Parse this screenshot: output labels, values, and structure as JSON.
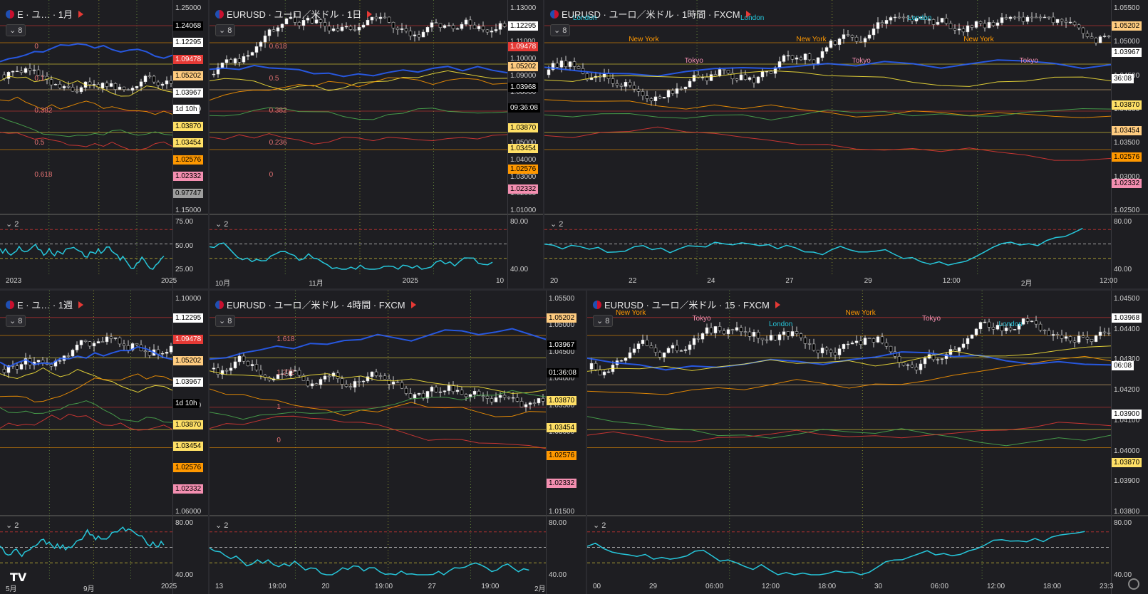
{
  "panes": [
    {
      "id": "p1",
      "title": "E · ユ… · 1月",
      "ind": "8",
      "osc": "2",
      "axis": [
        "1.25000",
        "1.20000",
        "1.15000",
        "75.00",
        "50.00",
        "25.00"
      ],
      "labels": [
        [
          "1.24068",
          "#000",
          "#fff"
        ],
        [
          "1.12295",
          "#fff",
          "#000"
        ],
        [
          "1.09478",
          "#e53935",
          "#fff"
        ],
        [
          "1.05202",
          "#ffcc80",
          "#000"
        ],
        [
          "1.03967",
          "#fff",
          "#000"
        ],
        [
          "1d 10h",
          "#fff",
          "#000"
        ],
        [
          "1.03870",
          "#ffe066",
          "#000"
        ],
        [
          "1.03454",
          "#ffe066",
          "#000"
        ],
        [
          "1.02576",
          "#ff9800",
          "#000"
        ],
        [
          "1.02332",
          "#f48fb1",
          "#000"
        ],
        [
          "0.97747",
          "#9e9e9e",
          "#000"
        ]
      ],
      "xl": [
        "2023",
        "2025"
      ],
      "fib": [
        "0",
        "0.1",
        "0.382",
        "0.5",
        "0.618"
      ]
    },
    {
      "id": "p2",
      "title": "EURUSD · ユーロ／米ドル · 1日",
      "ind": "8",
      "osc": "2",
      "axis": [
        "1.13000",
        "1.12000",
        "1.11000",
        "1.10000",
        "1.09000",
        "1.08000",
        "1.07000",
        "1.06000",
        "1.05000",
        "1.04000",
        "1.03000",
        "1.02000",
        "1.01000",
        "80.00",
        "40.00"
      ],
      "labels": [
        [
          "1.12295",
          "#fff",
          "#000"
        ],
        [
          "1.09478",
          "#e53935",
          "#fff"
        ],
        [
          "1.05202",
          "#ffcc80",
          "#000"
        ],
        [
          "1.03968",
          "#000",
          "#fff"
        ],
        [
          "09:36:08",
          "#000",
          "#fff"
        ],
        [
          "1.03870",
          "#ffe066",
          "#000"
        ],
        [
          "1.03454",
          "#ffe066",
          "#000"
        ],
        [
          "1.02576",
          "#ff9800",
          "#000"
        ],
        [
          "1.02332",
          "#f48fb1",
          "#000"
        ]
      ],
      "xl": [
        "10月",
        "11月",
        "2025",
        "10"
      ],
      "fib": [
        "0.618",
        "0.5",
        "0.382",
        "0.236",
        "0"
      ]
    },
    {
      "id": "p3",
      "title": "EURUSD · ユーロ／米ドル · 1時間 · FXCM",
      "ind": "8",
      "osc": "2",
      "axis": [
        "1.05500",
        "1.05000",
        "1.04500",
        "1.04000",
        "1.03500",
        "1.03000",
        "1.02500",
        "80.00",
        "40.00"
      ],
      "labels": [
        [
          "1.05202",
          "#ffcc80",
          "#000"
        ],
        [
          "1.03967",
          "#fff",
          "#000"
        ],
        [
          "36:08",
          "#fff",
          "#000"
        ],
        [
          "1.03870",
          "#ffe066",
          "#000"
        ],
        [
          "1.03454",
          "#ffcc80",
          "#000"
        ],
        [
          "1.02576",
          "#ff9800",
          "#000"
        ],
        [
          "1.02332",
          "#f48fb1",
          "#000"
        ]
      ],
      "xl": [
        "20",
        "22",
        "24",
        "27",
        "29",
        "12:00",
        "2月",
        "12:00"
      ],
      "sessions": [
        "London",
        "New York",
        "Tokyo",
        "London",
        "New York",
        "Tokyo",
        "London",
        "New York",
        "Tokyo"
      ]
    },
    {
      "id": "p4",
      "title": "E · ユ… · 1週",
      "ind": "8",
      "osc": "2",
      "axis": [
        "1.10000",
        "1.08000",
        "1.06000",
        "80.00",
        "40.00"
      ],
      "labels": [
        [
          "1.12295",
          "#fff",
          "#000"
        ],
        [
          "1.09478",
          "#e53935",
          "#fff"
        ],
        [
          "1.05202",
          "#ffcc80",
          "#000"
        ],
        [
          "1.03967",
          "#fff",
          "#000"
        ],
        [
          "1d 10h",
          "#000",
          "#fff"
        ],
        [
          "1.03870",
          "#ffe066",
          "#000"
        ],
        [
          "1.03454",
          "#ffe066",
          "#000"
        ],
        [
          "1.02576",
          "#ff9800",
          "#000"
        ],
        [
          "1.02332",
          "#f48fb1",
          "#000"
        ]
      ],
      "xl": [
        "5月",
        "9月",
        "2025"
      ]
    },
    {
      "id": "p5",
      "title": "EURUSD · ユーロ／米ドル · 4時間 · FXCM",
      "ind": "8",
      "osc": "2",
      "axis": [
        "1.05500",
        "1.05000",
        "1.04500",
        "1.04000",
        "1.03500",
        "1.03000",
        "1.02500",
        "1.02000",
        "1.01500",
        "80.00",
        "40.00"
      ],
      "labels": [
        [
          "1.05202",
          "#ffcc80",
          "#000"
        ],
        [
          "1.03967",
          "#000",
          "#fff"
        ],
        [
          "01:36:08",
          "#000",
          "#fff"
        ],
        [
          "1.03870",
          "#ffe066",
          "#000"
        ],
        [
          "1.03454",
          "#ffe066",
          "#000"
        ],
        [
          "1.02576",
          "#ff9800",
          "#000"
        ],
        [
          "1.02332",
          "#f48fb1",
          "#000"
        ]
      ],
      "xl": [
        "13",
        "19:00",
        "20",
        "19:00",
        "27",
        "19:00",
        "2月"
      ],
      "fib": [
        "1.618",
        "1.272",
        "1",
        "0"
      ]
    },
    {
      "id": "p6",
      "title": "EURUSD · ユーロ／米ドル · 15 · FXCM",
      "ind": "8",
      "osc": "2",
      "axis": [
        "1.04500",
        "1.04400",
        "1.04300",
        "1.04200",
        "1.04100",
        "1.04000",
        "1.03900",
        "1.03800",
        "80.00",
        "40.00"
      ],
      "labels": [
        [
          "1.03968",
          "#fff",
          "#000"
        ],
        [
          "06:08",
          "#fff",
          "#000"
        ],
        [
          "1.03900",
          "#fff",
          "#000"
        ],
        [
          "1.03870",
          "#ffe066",
          "#000"
        ]
      ],
      "xl": [
        "00",
        "29",
        "06:00",
        "12:00",
        "18:00",
        "30",
        "06:00",
        "12:00",
        "18:00",
        "23:3"
      ],
      "sessions": [
        "New York",
        "Tokyo",
        "London",
        "New York",
        "Tokyo",
        "London"
      ]
    }
  ],
  "colors": {
    "bg": "#1e1e22",
    "grid": "#2f2f35",
    "bull": "#ffffff",
    "bear": "#000000",
    "ma_blue": "#2962ff",
    "rsi": "#26c6da"
  }
}
